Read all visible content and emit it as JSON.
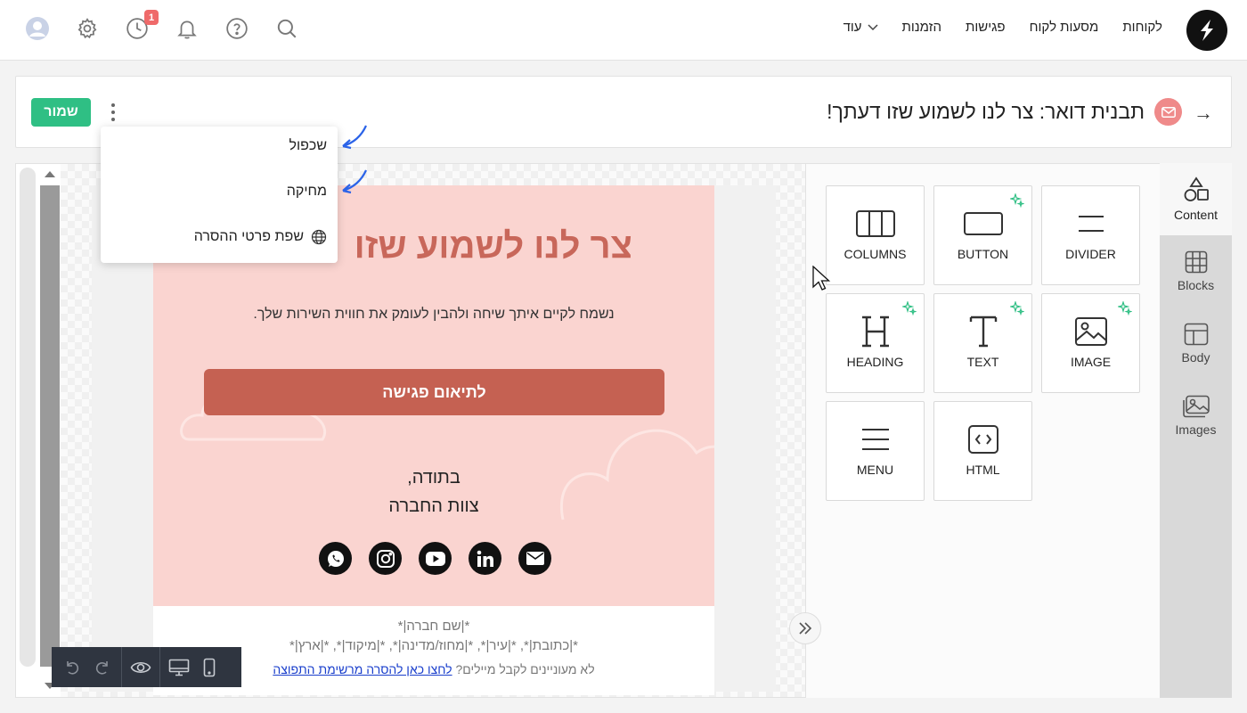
{
  "topnav": {
    "items": [
      "לקוחות",
      "מסעות לקוח",
      "פגישות",
      "הזמנות"
    ],
    "more_label": "עוד",
    "notification_count": "1",
    "icons": [
      "search-icon",
      "help-icon",
      "bell-icon",
      "history-icon",
      "gear-icon",
      "avatar-icon"
    ]
  },
  "header": {
    "title": "תבנית דואר: צר לנו לשמוע שזו דעתך!",
    "save_label": "שמור"
  },
  "dropdown": {
    "items": [
      "שכפול",
      "מחיקה",
      "שפת פרטי ההסרה"
    ]
  },
  "email": {
    "heading": "צר לנו לשמוע שזו",
    "paragraph": "נשמח לקיים איתך שיחה ולהבין לעומק את חווית השירות שלך.",
    "cta_label": "לתיאום פגישה",
    "thanks_line1": "בתודה,",
    "thanks_line2": "צוות החברה",
    "footer_company": "*|שם חברה|*",
    "footer_address": "*|כתובת|*, *|עיר|*, *|מחוז/מדינה|*, *|מיקוד|*, *|ארץ|*",
    "footer_unsub_prefix": "לא מעוניינים לקבל מיילים?",
    "footer_unsub_link": "לחצו כאן להסרה מרשימת התפוצה",
    "social_icons": [
      "whatsapp-icon",
      "instagram-icon",
      "youtube-icon",
      "linkedin-icon",
      "email-icon"
    ]
  },
  "content_tiles": {
    "columns": "COLUMNS",
    "button": "BUTTON",
    "divider": "DIVIDER",
    "heading": "HEADING",
    "text": "TEXT",
    "image": "IMAGE",
    "menu": "MENU",
    "html": "HTML"
  },
  "sidetabs": {
    "content": "Content",
    "blocks": "Blocks",
    "body": "Body",
    "images": "Images"
  },
  "colors": {
    "accent_green": "#2fbf84",
    "email_pink": "#fad4d0",
    "email_heading": "#c8675a",
    "cta": "#c56152",
    "spark": "#2fbf84"
  }
}
